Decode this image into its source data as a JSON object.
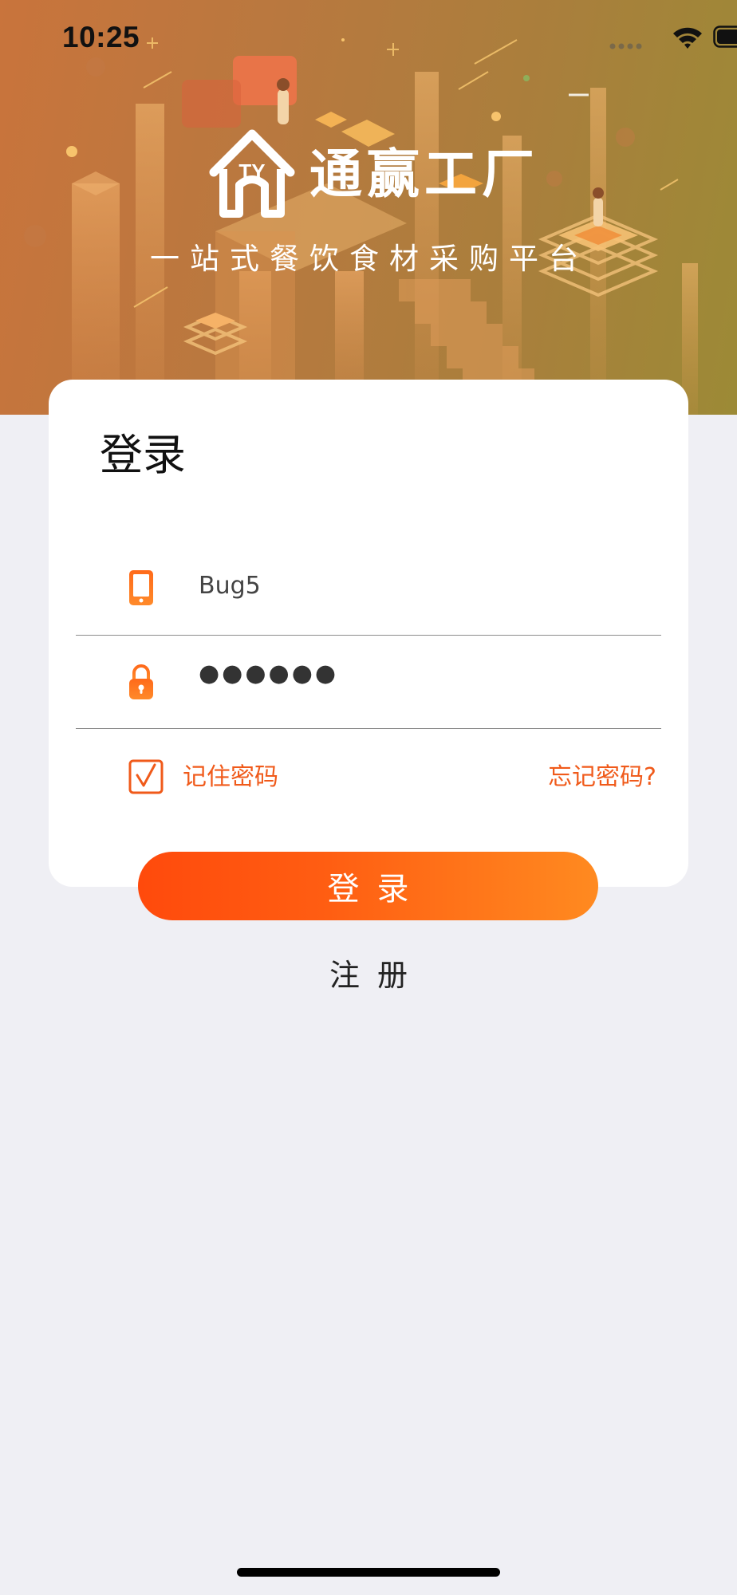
{
  "status_bar": {
    "time": "10:25"
  },
  "brand": {
    "name": "通赢工厂",
    "slogan": "一站式餐饮食材采购平台",
    "logo_mark": "TY"
  },
  "login_form": {
    "title": "登录",
    "username_value": "Bug5",
    "password_value": "●●●●●●",
    "remember_label": "记住密码",
    "remember_checked": true,
    "forgot_label": "忘记密码?",
    "submit_label": "登录",
    "register_label": "注册"
  },
  "colors": {
    "accent": "#f05a1a",
    "button_start": "#ff4a0c",
    "button_end": "#ff8a20",
    "page_background": "#efeff4"
  },
  "icons": {
    "username": "phone-icon",
    "password": "lock-icon",
    "remember": "checkbox-checked-icon"
  }
}
